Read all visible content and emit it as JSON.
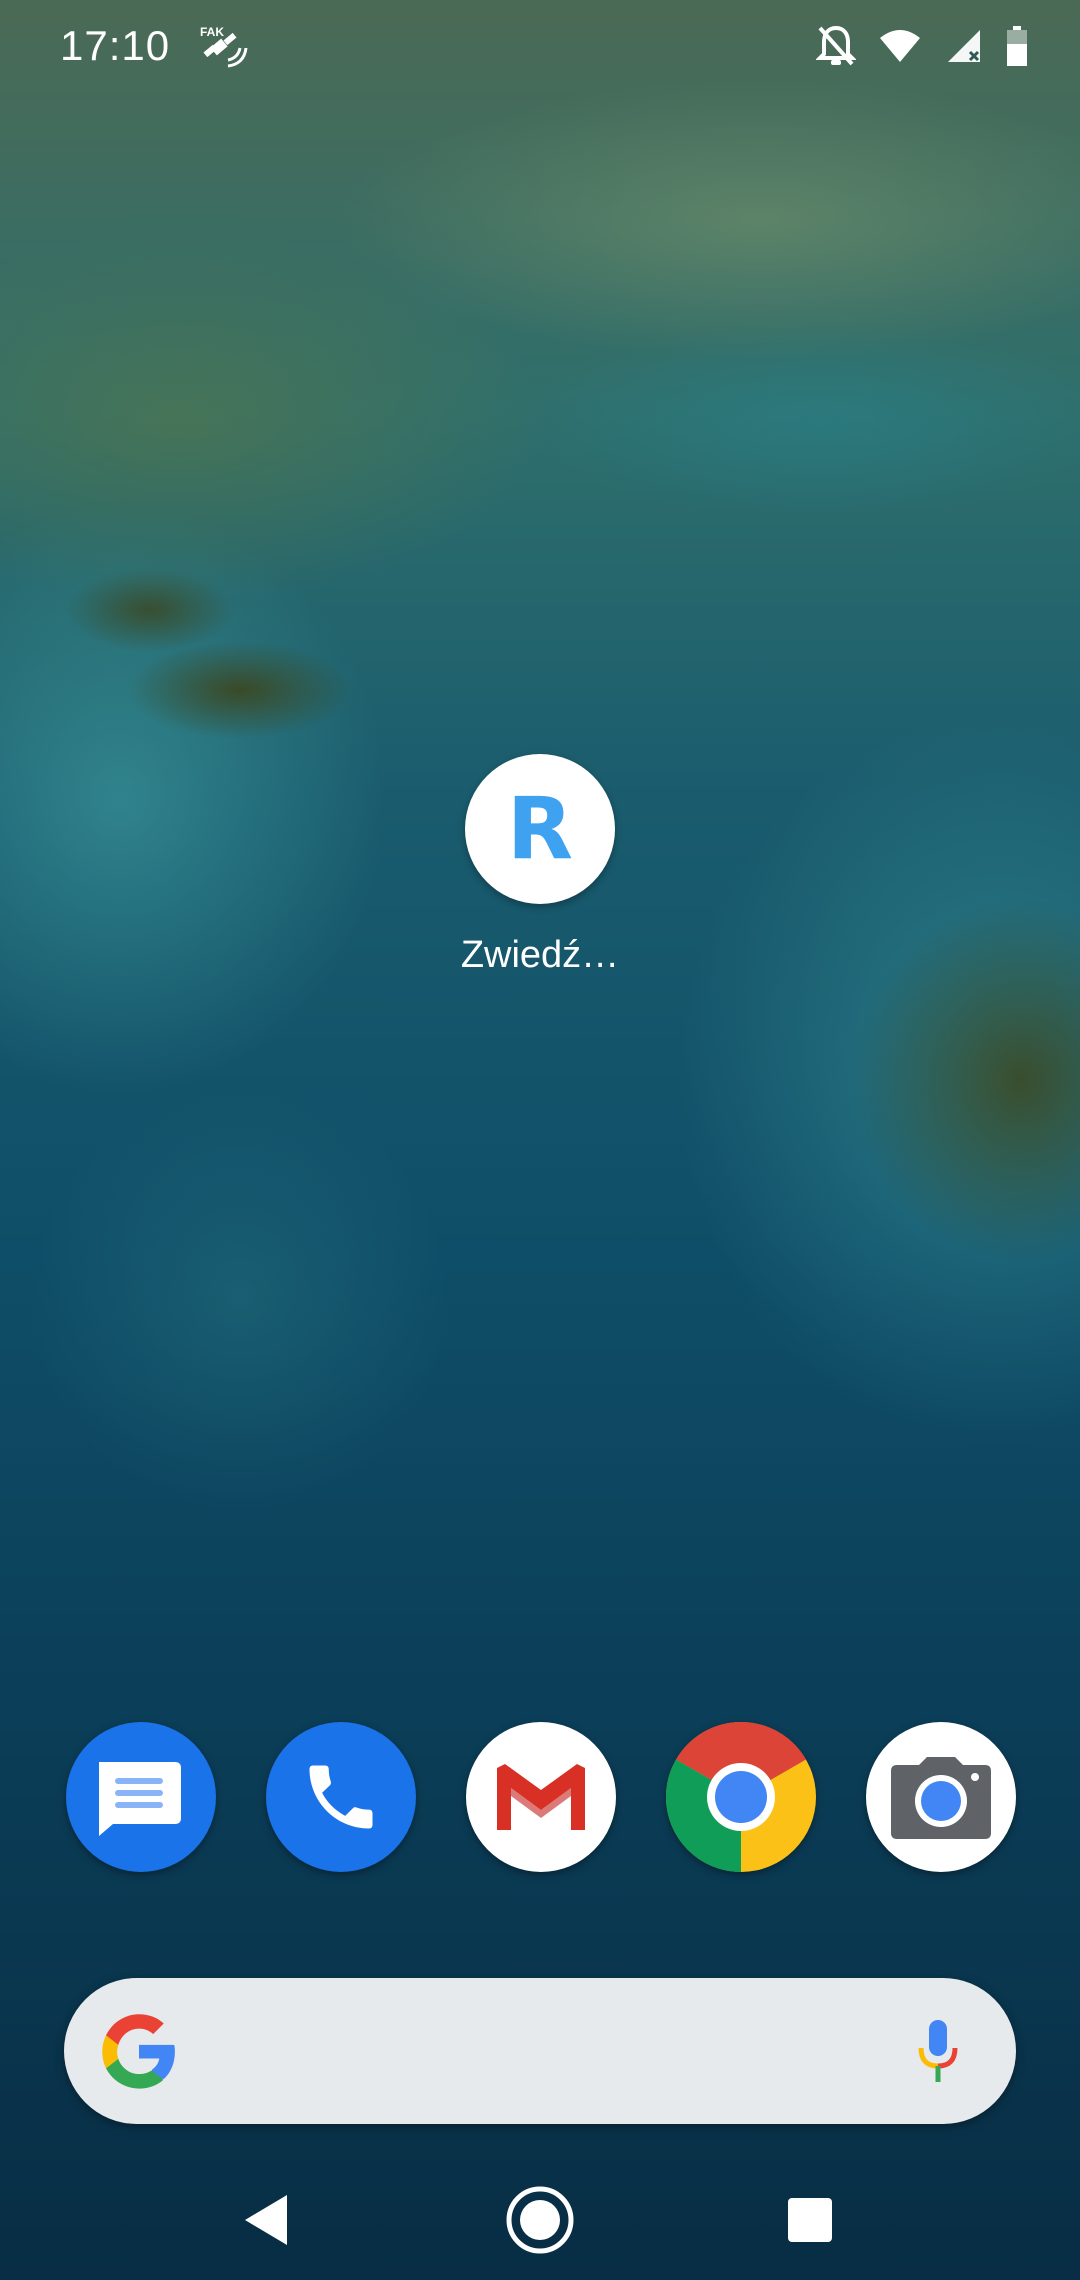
{
  "status_bar": {
    "time": "17:10",
    "icons": [
      "fake-gps-icon",
      "notifications-off-icon",
      "wifi-icon",
      "cell-signal-icon",
      "battery-icon"
    ]
  },
  "home_screen": {
    "shortcut": {
      "letter": "R",
      "label": "Zwiedź…",
      "color": "#3fa2f0"
    }
  },
  "dock": {
    "apps": [
      {
        "name": "Messages",
        "icon": "messages-icon"
      },
      {
        "name": "Phone",
        "icon": "phone-icon"
      },
      {
        "name": "Gmail",
        "icon": "gmail-icon"
      },
      {
        "name": "Chrome",
        "icon": "chrome-icon"
      },
      {
        "name": "Camera",
        "icon": "camera-icon"
      }
    ]
  },
  "search_bar": {
    "value": "",
    "placeholder": ""
  },
  "nav_bar": {
    "buttons": [
      "back-icon",
      "home-icon",
      "recents-icon"
    ]
  }
}
